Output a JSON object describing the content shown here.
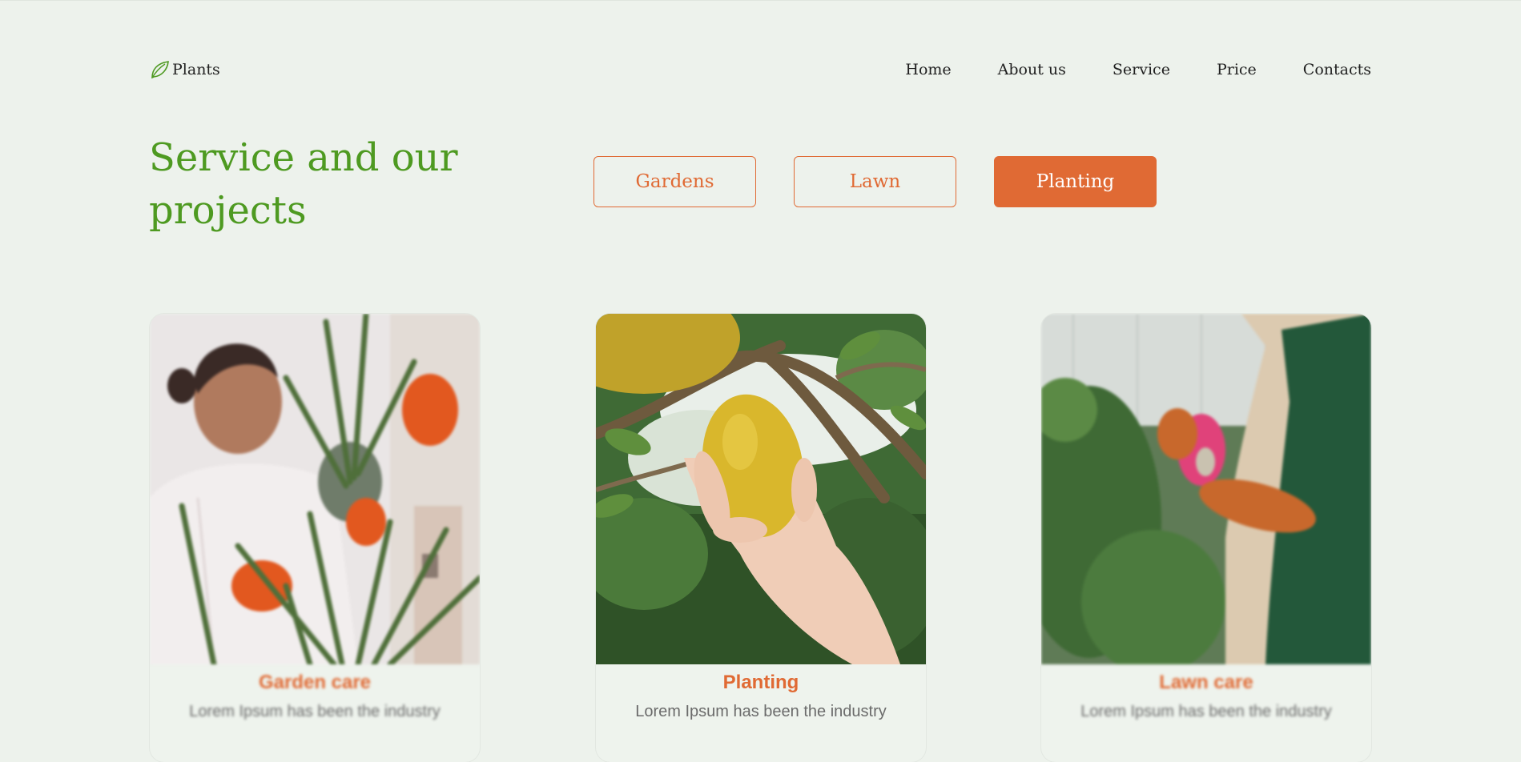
{
  "header": {
    "logo_text": "Plants",
    "logo_icon": "leaf-icon",
    "nav": [
      {
        "label": "Home"
      },
      {
        "label": "About us"
      },
      {
        "label": "Service"
      },
      {
        "label": "Price"
      },
      {
        "label": "Contacts"
      }
    ]
  },
  "section": {
    "title": "Service and our projects"
  },
  "filters": [
    {
      "label": "Gardens",
      "active": false
    },
    {
      "label": "Lawn",
      "active": false
    },
    {
      "label": "Planting",
      "active": true
    }
  ],
  "cards": [
    {
      "title": "Garden care",
      "text": "Lorem Ipsum has been the industry",
      "blurred": true
    },
    {
      "title": "Planting",
      "text": "Lorem Ipsum has been the industry",
      "blurred": false
    },
    {
      "title": "Lawn care",
      "text": "Lorem Ipsum has been the industry",
      "blurred": true
    }
  ],
  "colors": {
    "background": "#EDF2EC",
    "accent_green": "#4E9A21",
    "accent_orange": "#E06A34"
  }
}
